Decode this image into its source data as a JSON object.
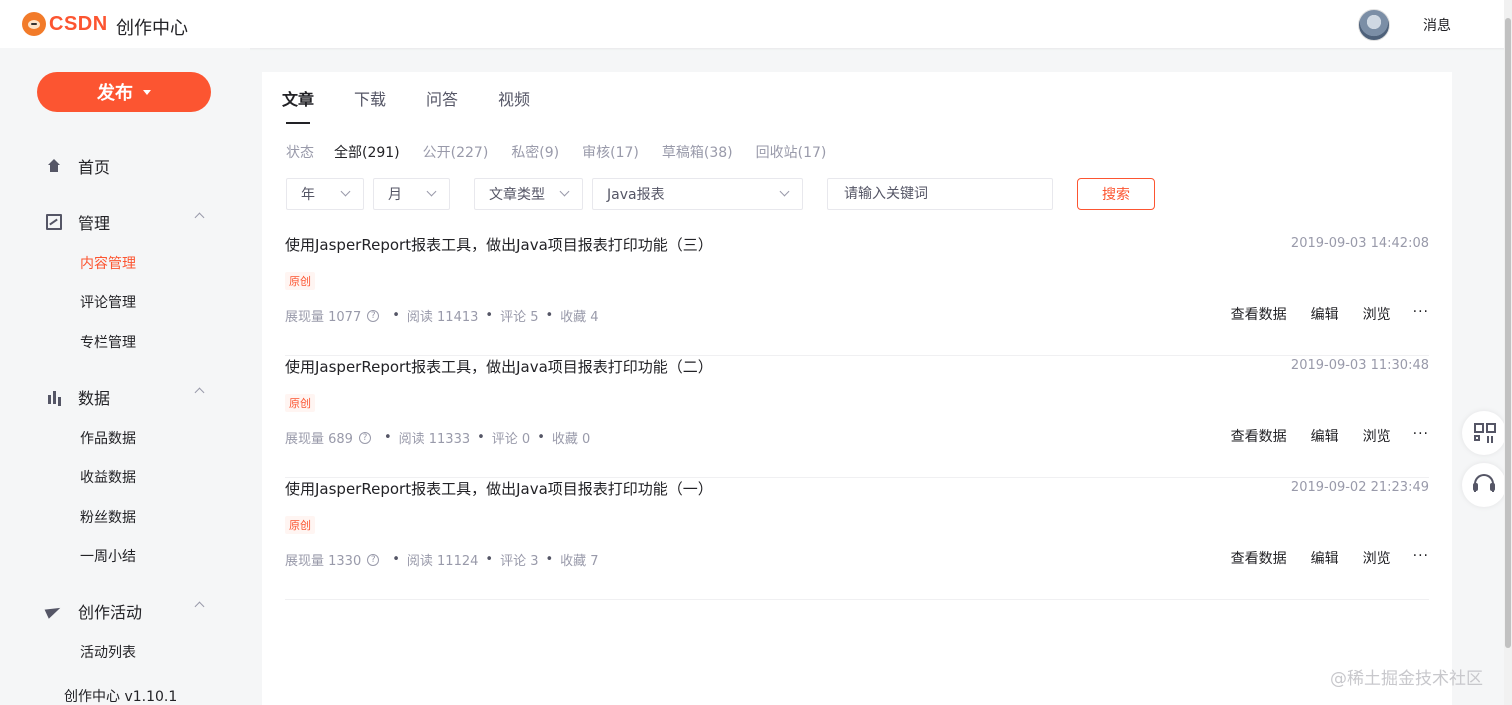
{
  "header": {
    "logo_text": "CSDN",
    "title": "创作中心",
    "message_label": "消息"
  },
  "sidebar": {
    "publish_label": "发布",
    "home": "首页",
    "manage": {
      "label": "管理",
      "items": [
        "内容管理",
        "评论管理",
        "专栏管理"
      ]
    },
    "data": {
      "label": "数据",
      "items": [
        "作品数据",
        "收益数据",
        "粉丝数据",
        "一周小结"
      ]
    },
    "activity": {
      "label": "创作活动",
      "items": [
        "活动列表"
      ]
    },
    "version": "创作中心 v1.10.1"
  },
  "main": {
    "tabs": [
      "文章",
      "下载",
      "问答",
      "视频"
    ],
    "status_label": "状态",
    "status_items": [
      "全部(291)",
      "公开(227)",
      "私密(9)",
      "审核(17)",
      "草稿箱(38)",
      "回收站(17)"
    ],
    "filters": {
      "year": "年",
      "month": "月",
      "type": "文章类型",
      "column": "Java报表"
    },
    "search_placeholder": "请输入关键词",
    "search_button": "搜索",
    "articles": [
      {
        "title": "使用JasperReport报表工具，做出Java项目报表打印功能（三）",
        "time": "2019-09-03 14:42:08",
        "tag": "原创",
        "views": "展现量 1077",
        "reads": "阅读 11413",
        "comments": "评论 5",
        "favorites": "收藏 4"
      },
      {
        "title": "使用JasperReport报表工具，做出Java项目报表打印功能（二）",
        "time": "2019-09-03 11:30:48",
        "tag": "原创",
        "views": "展现量 689",
        "reads": "阅读 11333",
        "comments": "评论 0",
        "favorites": "收藏 0"
      },
      {
        "title": "使用JasperReport报表工具，做出Java项目报表打印功能（一）",
        "time": "2019-09-02 21:23:49",
        "tag": "原创",
        "views": "展现量 1330",
        "reads": "阅读 11124",
        "comments": "评论 3",
        "favorites": "收藏 7"
      }
    ],
    "actions": {
      "stats": "查看数据",
      "edit": "编辑",
      "browse": "浏览",
      "more": "···"
    }
  },
  "watermark": "@稀土掘金技术社区",
  "colors": {
    "accent": "#fc5531",
    "text": "#222226",
    "muted": "#999aaa",
    "bg": "#f5f6f7"
  }
}
